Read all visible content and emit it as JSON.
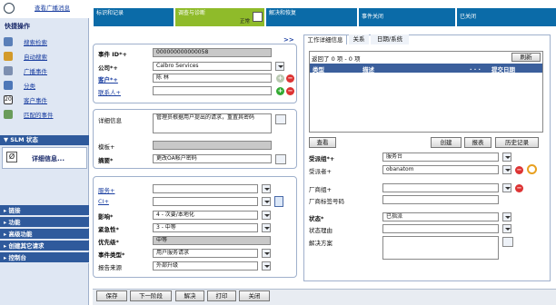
{
  "left": {
    "top_link": "查看广播消息",
    "quick_header": "快捷操作",
    "quick_items": [
      {
        "label": "搜索检索",
        "icon": "search-user-icon"
      },
      {
        "label": "自动搜索",
        "icon": "auto-search-icon"
      },
      {
        "label": "广播事件",
        "icon": "broadcast-icon"
      },
      {
        "label": "分类",
        "icon": "categorize-icon"
      },
      {
        "label": "客户事件",
        "icon": "calendar-icon"
      },
      {
        "label": "匹配的事件",
        "icon": "matched-incidents-icon"
      }
    ],
    "slm_header": "▼ SLM 状态",
    "slm_details": "详细信息...",
    "slm_icon_glyph": "Ø",
    "nav": [
      "▸ 链接",
      "▸ 功能",
      "▸ 高级功能",
      "▸ 创建其它请求",
      "▸ 控制台"
    ]
  },
  "steps": [
    {
      "label": "标识和记录",
      "sub": ""
    },
    {
      "label": "调查与诊断",
      "sub": "正常"
    },
    {
      "label": "解决和恢复",
      "sub": ""
    },
    {
      "label": "事件关闭",
      "sub": ""
    },
    {
      "label": "已关闭",
      "sub": ""
    }
  ],
  "expand_glyph": ">>",
  "form": {
    "incident_id_label": "事件 ID*+",
    "incident_id_value": "000000000000058",
    "company_label": "公司*+",
    "company_value": "Calbro Services",
    "customer_label": "客户*+",
    "customer_value": "陈 林",
    "contact_label": "联系人+",
    "notes_label": "详细信息",
    "notes_value": "管理员根据用户提出的请求，重置其密码",
    "template_label": "模板+",
    "summary_label": "摘要*",
    "summary_value": "更改OA帐户密码",
    "service_label": "服务+",
    "ci_label": "CI+",
    "impact_label": "影响*",
    "impact_value": "4 - 次要/本地化",
    "urgency_label": "紧急性*",
    "urgency_value": "3 - 中等",
    "priority_label": "优先级*",
    "priority_value": "中等",
    "type_label": "事件类型*",
    "type_value": "用户服务请求",
    "source_label": "报告来源",
    "source_value": "外部升级"
  },
  "right": {
    "tabs": [
      "工作详细信息",
      "关系",
      "日期/系统"
    ],
    "record_count": "返回了 0 项 - 0 项",
    "refresh_label": "刷新",
    "col_type": "类型",
    "col_desc": "描述",
    "col_more": ". . .",
    "col_date": "提交日期",
    "view_label": "查看",
    "create_label": "创建",
    "report_label": "报表",
    "history_label": "历史记录",
    "group_label": "受派组*+",
    "group_value": "服务台",
    "assignee_label": "受派者+",
    "assignee_value": "obanatom",
    "vendor_group_label": "厂商组+",
    "vendor_ticket_label": "厂商标签号码",
    "status_label": "状态*",
    "status_value": "已指派",
    "reason_label": "状态理由",
    "resolution_label": "解决方案"
  },
  "buttons": [
    "保存",
    "下一阶段",
    "解决",
    "打印",
    "关闭"
  ]
}
